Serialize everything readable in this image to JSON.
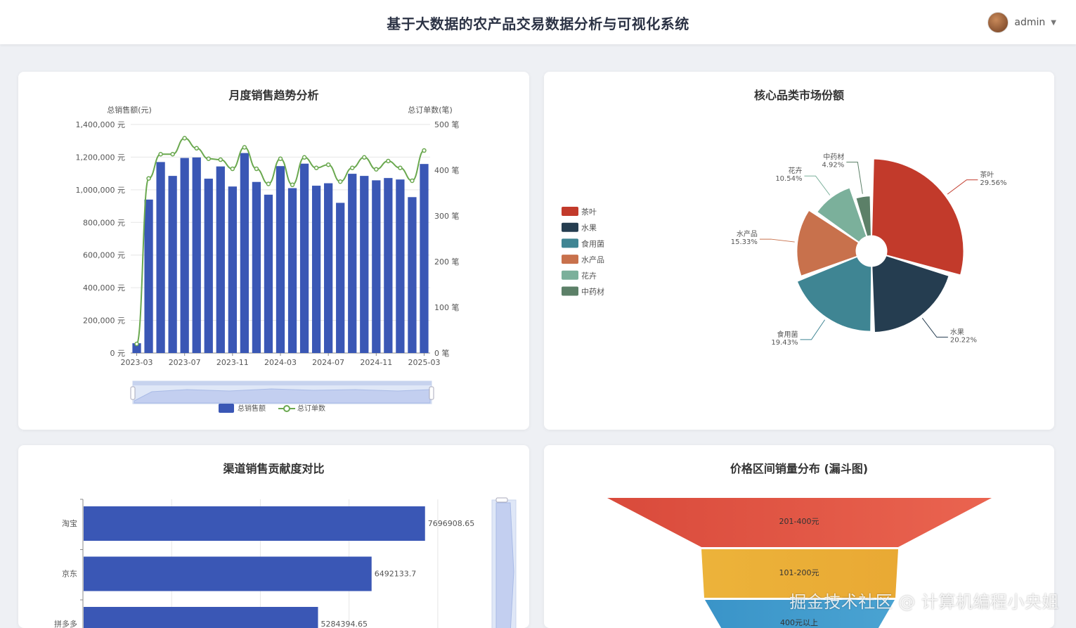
{
  "header": {
    "title": "基于大数据的农产品交易数据分析与可视化系统",
    "user_name": "admin",
    "user_caret": "▼"
  },
  "colors": {
    "bar_blue": "#3a57b5",
    "line_green": "#6aa84f",
    "funnel": [
      "#e0503f",
      "#f0b83d",
      "#3a96c9"
    ]
  },
  "icons": {
    "avatar": "avatar-image",
    "dropdown": "chevron-down-icon",
    "legend_bar": "bar-legend-icon",
    "legend_line": "line-legend-icon"
  },
  "chart_data": [
    {
      "type": "bar",
      "title": "月度销售趋势分析",
      "y_left_label": "总销售额(元)",
      "y_right_label": "总订单数(笔)",
      "y_left_ticks": [
        "0 元",
        "200,000 元",
        "400,000 元",
        "600,000 元",
        "800,000 元",
        "1,000,000 元",
        "1,200,000 元",
        "1,400,000 元"
      ],
      "y_right_ticks": [
        "0 笔",
        "100 笔",
        "200 笔",
        "300 笔",
        "400 笔",
        "500 笔"
      ],
      "x_ticks": [
        "2023-03",
        "2023-07",
        "2023-11",
        "2024-03",
        "2024-07",
        "2024-11",
        "2025-03"
      ],
      "ylim_left": [
        0,
        1400000
      ],
      "ylim_right": [
        0,
        500
      ],
      "series": [
        {
          "name": "总销售额",
          "type": "bar",
          "values": [
            60000,
            940000,
            1170000,
            1085000,
            1195000,
            1198000,
            1068000,
            1143000,
            1020000,
            1225000,
            1048000,
            970000,
            1145000,
            1010000,
            1160000,
            1025000,
            1040000,
            920000,
            1098000,
            1085000,
            1058000,
            1072000,
            1063000,
            955000,
            1158000
          ]
        },
        {
          "name": "总订单数",
          "type": "line",
          "values": [
            20,
            382,
            435,
            435,
            470,
            448,
            425,
            423,
            403,
            450,
            403,
            370,
            425,
            368,
            428,
            405,
            412,
            375,
            405,
            428,
            402,
            420,
            405,
            377,
            443
          ]
        }
      ],
      "legend": [
        "总销售额",
        "总订单数"
      ]
    },
    {
      "type": "pie",
      "title": "核心品类市场份额",
      "legend": [
        "茶叶",
        "水果",
        "食用菌",
        "水产品",
        "花卉",
        "中药材"
      ],
      "slices": [
        {
          "name": "茶叶",
          "value": 29.56,
          "label": "29.56%",
          "color": "#c23a2b"
        },
        {
          "name": "水果",
          "value": 20.22,
          "label": "20.22%",
          "color": "#253d50"
        },
        {
          "name": "食用菌",
          "value": 19.43,
          "label": "19.43%",
          "color": "#3f8593"
        },
        {
          "name": "水产品",
          "value": 15.33,
          "label": "15.33%",
          "color": "#c8714c"
        },
        {
          "name": "花卉",
          "value": 10.54,
          "label": "10.54%",
          "color": "#7bb09b"
        },
        {
          "name": "中药材",
          "value": 4.92,
          "label": "4.92%",
          "color": "#5c8068"
        }
      ]
    },
    {
      "type": "bar",
      "title": "渠道销售贡献度对比",
      "categories": [
        "淘宝",
        "京东",
        "拼多多"
      ],
      "values": [
        7696908.65,
        6492133.7,
        5284394.65
      ],
      "value_labels": [
        "7696908.65",
        "6492133.7",
        "5284394.65"
      ],
      "orientation": "horizontal"
    },
    {
      "type": "funnel",
      "title": "价格区间销量分布 (漏斗图)",
      "stages": [
        "201-400元",
        "101-200元",
        "400元以上"
      ]
    }
  ],
  "watermark": "掘金技术社区 @ 计算机编程小央姐"
}
